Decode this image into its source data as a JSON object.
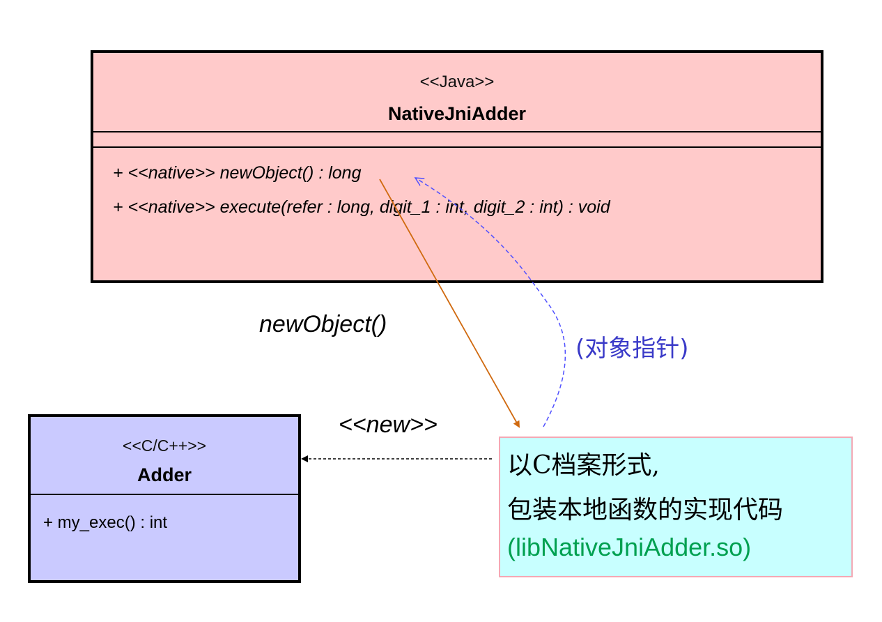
{
  "java_class": {
    "stereotype": "<<Java>>",
    "name": "NativeJniAdder",
    "operations": [
      "+ <<native>> newObject() : long",
      "+ <<native>> execute(refer : long, digit_1 : int, digit_2 : int) : void"
    ],
    "fill_color": "#ffcaca"
  },
  "c_class": {
    "stereotype": "<<C/C++>>",
    "name": "Adder",
    "operations": [
      "+ my_exec() : int"
    ],
    "fill_color": "#cacaff"
  },
  "labels": {
    "newobject_call": "newObject()",
    "new_stereotype": "<<new>>",
    "object_pointer": "(对象指针)"
  },
  "note": {
    "line1": "以C档案形式,",
    "line2": "包装本地函数的实现代码",
    "line3": "(libNativeJniAdder.so)",
    "fill_color": "#c8ffff",
    "library_color": "#00a050"
  },
  "connectors": [
    {
      "name": "call-arrow",
      "style": "solid",
      "color": "#d06a10"
    },
    {
      "name": "return-arrow",
      "style": "dashed",
      "color": "#5050ff"
    },
    {
      "name": "create-arrow",
      "style": "dashed",
      "color": "#000000"
    }
  ]
}
